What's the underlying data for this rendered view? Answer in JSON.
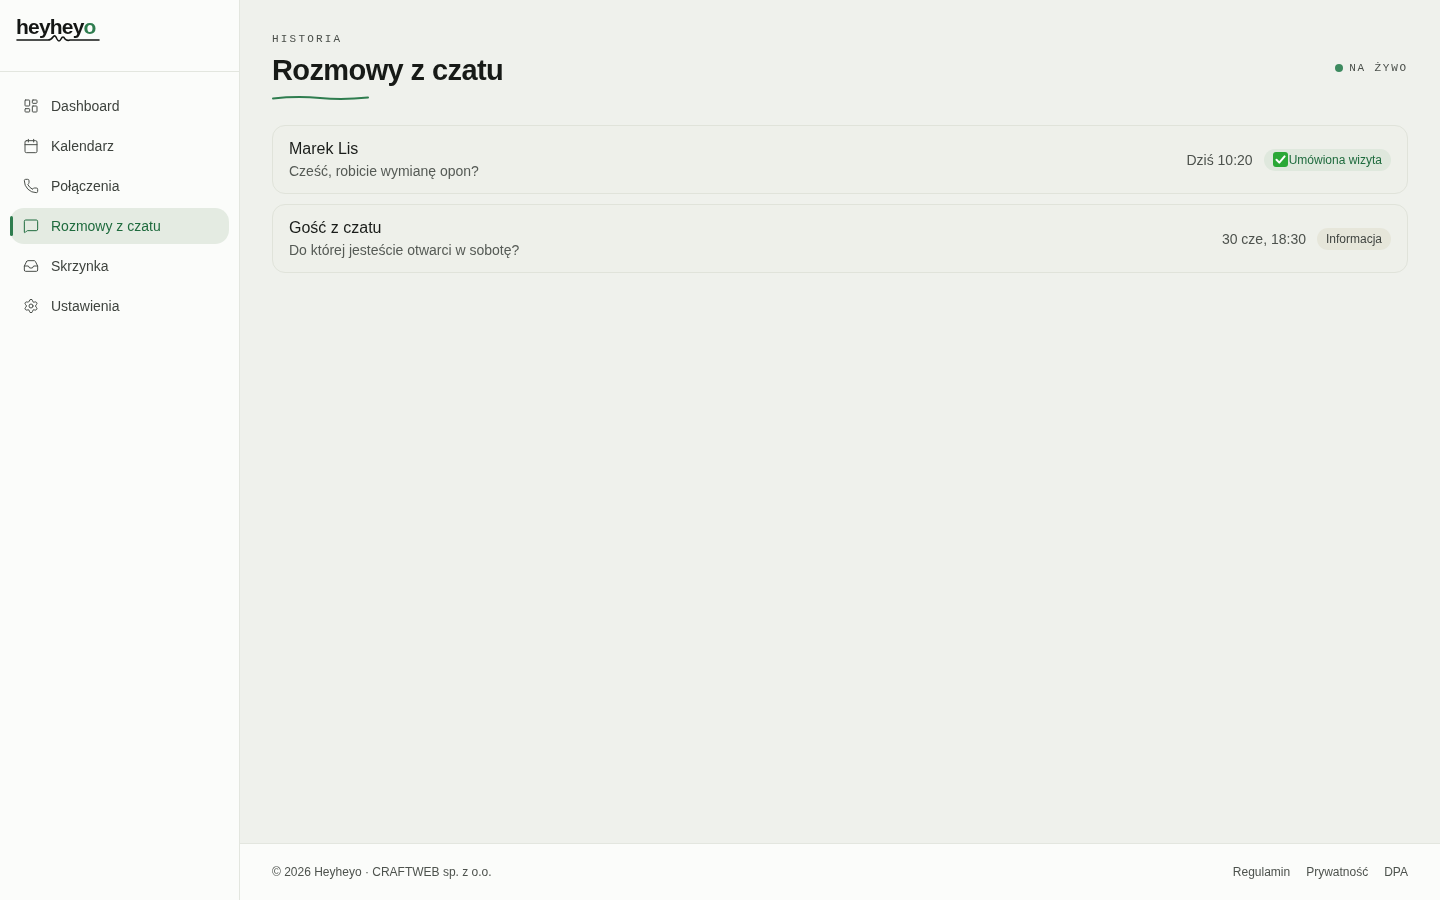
{
  "logo": {
    "text": "heyhey",
    "accent": "o"
  },
  "sidebar": {
    "items": [
      {
        "label": "Dashboard",
        "selected": false
      },
      {
        "label": "Kalendarz",
        "selected": false
      },
      {
        "label": "Połączenia",
        "selected": false
      },
      {
        "label": "Rozmowy z czatu",
        "selected": true
      },
      {
        "label": "Skrzynka",
        "selected": false
      },
      {
        "label": "Ustawienia",
        "selected": false
      }
    ]
  },
  "header": {
    "eyebrow": "HISTORIA",
    "title": "Rozmowy z czatu",
    "live": {
      "label": "NA ŻYWO",
      "on": true
    }
  },
  "conversations": [
    {
      "name": "Marek Lis",
      "preview": "Cześć, robicie wymianę opon?",
      "time": "Dziś 10:20",
      "tag": {
        "label": "Umówiona wizyta",
        "kind": "booked"
      }
    },
    {
      "name": "Gość z czatu",
      "preview": "Do której jesteście otwarci w sobotę?",
      "time": "30 cze, 18:30",
      "tag": {
        "label": "Informacja",
        "kind": "info"
      }
    }
  ],
  "footer": {
    "copyright": "© 2026 Heyheyo · CRAFTWEB sp. z o.o.",
    "links": [
      "Regulamin",
      "Prywatność",
      "DPA"
    ]
  }
}
